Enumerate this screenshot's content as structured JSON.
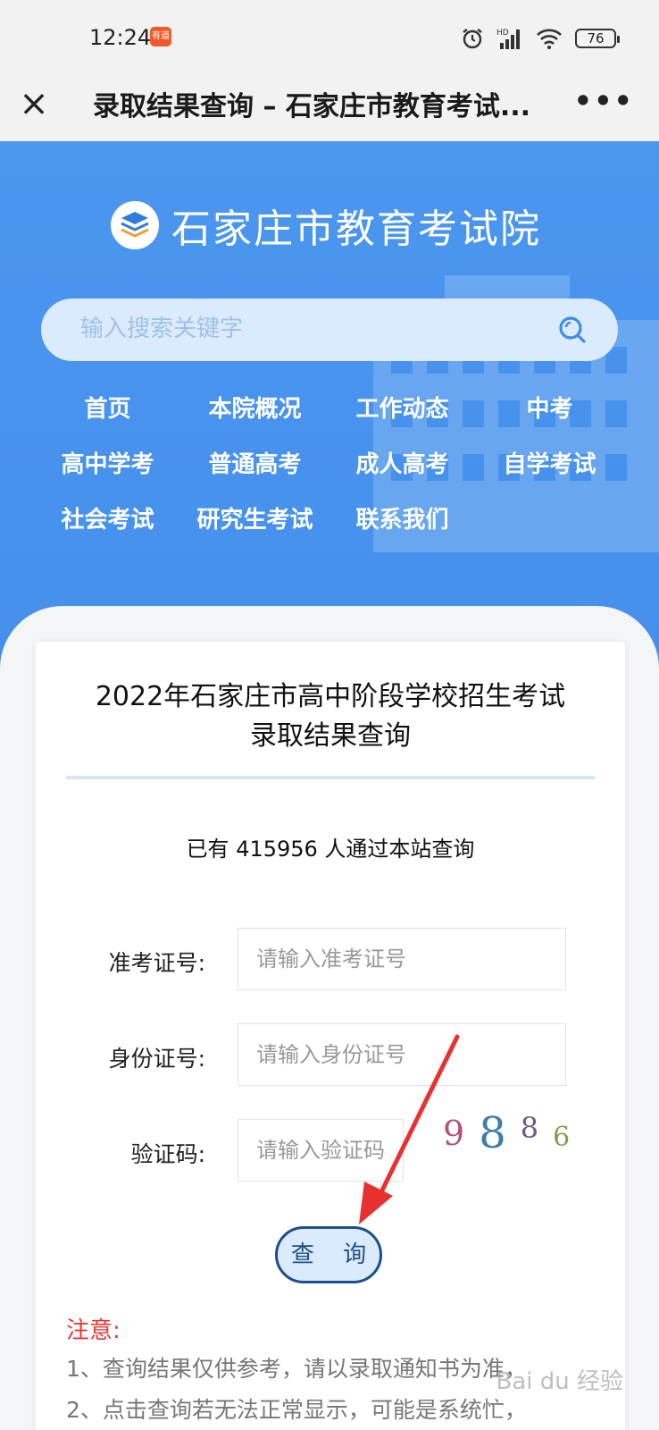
{
  "status_bar": {
    "time": "12:24",
    "app_badge": "有道",
    "battery": "76"
  },
  "title_bar": {
    "title": "录取结果查询 – 石家庄市教育考试..."
  },
  "header": {
    "brand_name": "石家庄市教育考试院",
    "search_placeholder": "输入搜索关键字",
    "nav": [
      "首页",
      "本院概况",
      "工作动态",
      "中考",
      "高中学考",
      "普通高考",
      "成人高考",
      "自学考试",
      "社会考试",
      "研究生考试",
      "联系我们"
    ]
  },
  "card": {
    "title_line1": "2022年石家庄市高中阶段学校招生考试",
    "title_line2": "录取结果查询",
    "visit_count": "已有 415956 人通过本站查询",
    "exam_id_label": "准考证号:",
    "exam_id_placeholder": "请输入准考证号",
    "id_card_label": "身份证号:",
    "id_card_placeholder": "请输入身份证号",
    "captcha_label": "验证码:",
    "captcha_placeholder": "请输入验证码",
    "captcha_digits": [
      "9",
      "8",
      "8",
      "6"
    ],
    "query_button": "查 询",
    "notice_title": "注意:",
    "notice_1": "1、查询结果仅供参考，请以录取通知书为准，",
    "notice_2": "2、点击查询若无法正常显示，可能是系统忙，"
  },
  "watermark": "Bai du 经验",
  "colors": {
    "primary_blue": "#4590ec",
    "button_border": "#1d4e89",
    "notice_red": "#e53935",
    "arrow_red": "#e8312f"
  }
}
